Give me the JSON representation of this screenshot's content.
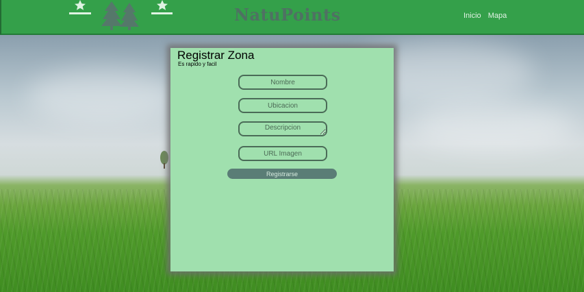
{
  "header": {
    "brand": "NatuPoints",
    "nav": [
      {
        "label": "Inicio"
      },
      {
        "label": "Mapa"
      }
    ]
  },
  "form": {
    "title": "Registrar Zona",
    "subtitle": "Es rapido y facil",
    "fields": {
      "nombre_placeholder": "Nombre",
      "ubicacion_placeholder": "Ubicacion",
      "descripcion_placeholder": "Descripcion",
      "url_imagen_placeholder": "URL Imagen"
    },
    "submit_label": "Registrarse"
  },
  "colors": {
    "header_bg": "#34a04a",
    "card_bg": "#a0e0ae",
    "button_bg": "#5a7d76"
  },
  "icons": [
    "star-icon",
    "tree-icon",
    "star-icon"
  ]
}
